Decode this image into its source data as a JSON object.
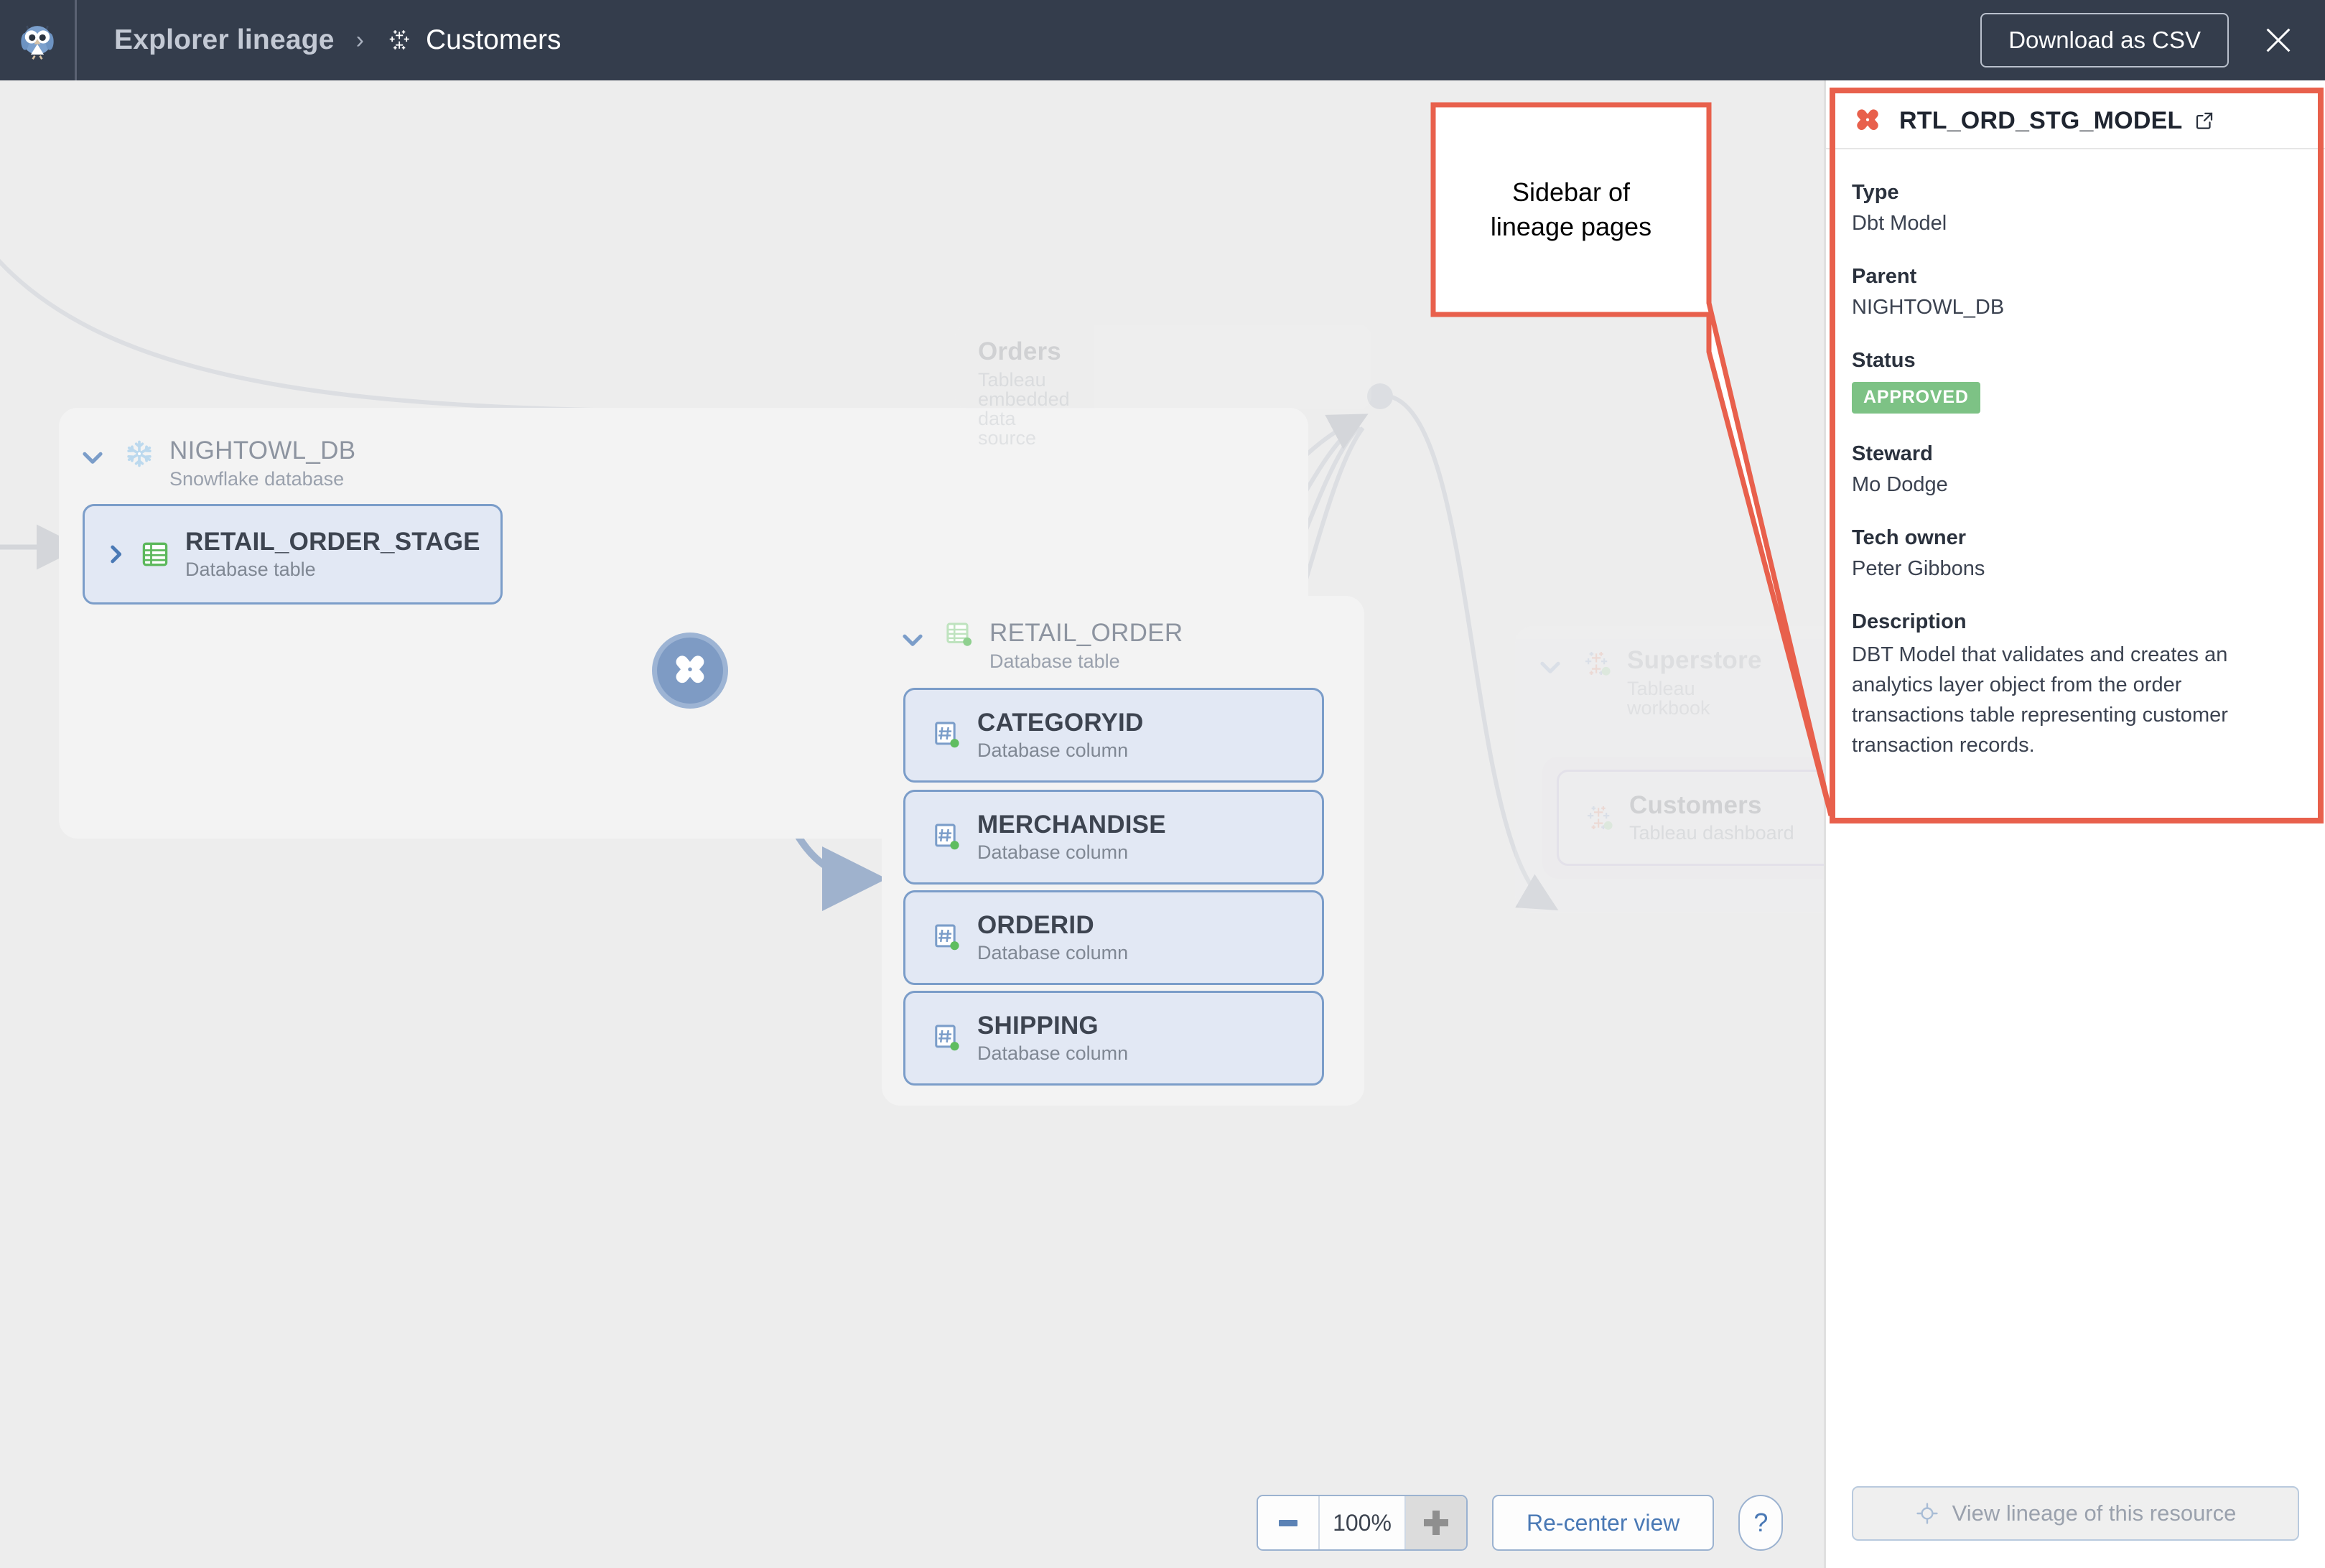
{
  "header": {
    "logo_icon": "owl-logo",
    "breadcrumb_root": "Explorer lineage",
    "breadcrumb_separator": "›",
    "breadcrumb_leaf_icon": "tableau-icon",
    "breadcrumb_leaf": "Customers",
    "download_button": "Download as CSV",
    "close_icon": "close-icon"
  },
  "canvas": {
    "background_color": "#ededed",
    "groups": [
      {
        "id": "nightowl-db",
        "icon": "snowflake-icon",
        "title": "NIGHTOWL_DB",
        "subtitle": "Snowflake database",
        "expanded": true,
        "faded": false
      },
      {
        "id": "retail-order",
        "icon": "database-table-icon",
        "title": "RETAIL_ORDER",
        "subtitle": "Database table",
        "expanded": true,
        "faded": false
      },
      {
        "id": "superstore",
        "icon": "tableau-icon",
        "title": "Superstore",
        "subtitle": "Tableau workbook",
        "expanded": true,
        "faded": true
      }
    ],
    "nodes": [
      {
        "id": "retail-order-stage",
        "icon": "database-table-icon",
        "title": "RETAIL_ORDER_STAGE",
        "subtitle": "Database table",
        "collapsed": true,
        "state": "normal"
      },
      {
        "id": "orders",
        "icon": "tableau-icon",
        "title": "Orders",
        "subtitle": "Tableau embedded data source",
        "collapsed": true,
        "state": "ghost"
      },
      {
        "id": "categoryid",
        "icon": "column-hash-icon",
        "title": "CATEGORYID",
        "subtitle": "Database column",
        "state": "normal"
      },
      {
        "id": "merchandise",
        "icon": "column-hash-icon",
        "title": "MERCHANDISE",
        "subtitle": "Database column",
        "state": "normal"
      },
      {
        "id": "orderid",
        "icon": "column-hash-icon",
        "title": "ORDERID",
        "subtitle": "Database column",
        "state": "normal"
      },
      {
        "id": "shipping",
        "icon": "column-hash-icon",
        "title": "SHIPPING",
        "subtitle": "Database column",
        "state": "normal"
      },
      {
        "id": "customers",
        "icon": "tableau-icon",
        "title": "Customers",
        "subtitle": "Tableau dashboard",
        "state": "focused"
      }
    ],
    "dbt_node": {
      "id": "dbt-model-node",
      "icon": "dbt-logo-icon"
    }
  },
  "toolbar": {
    "zoom_out_icon": "minus-icon",
    "zoom_level": "100%",
    "zoom_in_icon": "plus-icon",
    "recenter_label": "Re-center view",
    "help_label": "?"
  },
  "sidebar": {
    "icon": "dbt-logo-icon",
    "title": "RTL_ORD_STG_MODEL",
    "external_link_icon": "external-link-icon",
    "fields": [
      {
        "label": "Type",
        "value": "Dbt Model"
      },
      {
        "label": "Parent",
        "value": "NIGHTOWL_DB"
      }
    ],
    "status_label": "Status",
    "status_value": "APPROVED",
    "status_color": "#7dc285",
    "fields2": [
      {
        "label": "Steward",
        "value": "Mo Dodge"
      },
      {
        "label": "Tech owner",
        "value": "Peter Gibbons"
      }
    ],
    "description_label": "Description",
    "description_value": "DBT Model that validates and creates an analytics layer object from the order transactions table representing customer transaction records.",
    "footer_button": "View lineage of this resource",
    "footer_button_icon": "target-icon"
  },
  "annotation": {
    "callout_text": "Sidebar of\nlineage pages",
    "callout_line1": "Sidebar of",
    "callout_line2": "lineage pages",
    "accent_color": "#e8604c"
  }
}
